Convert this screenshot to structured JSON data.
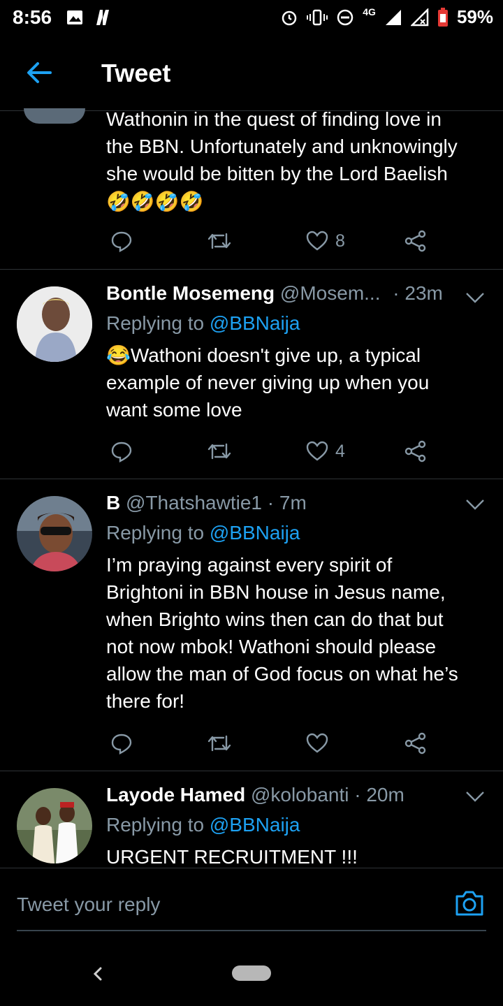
{
  "status_bar": {
    "time": "8:56",
    "network": "4G",
    "battery": "59%"
  },
  "app_bar": {
    "title": "Tweet"
  },
  "tweets": [
    {
      "body_lines": [
        "Wathonin in the quest of finding love in",
        "the BBN. Unfortunately and unknowingly",
        "she would be bitten by the Lord Baelish"
      ],
      "emoji": "🤣🤣🤣🤣",
      "likes": "8"
    },
    {
      "name": "Bontle Mosemeng",
      "handle": "@Mosem...",
      "time": "· 23m",
      "replying_label": "Replying to",
      "mention": "@BBNaija",
      "body_lines": [
        "😂Wathoni doesn't give up, a typical",
        "example of never giving up when you",
        "want some love"
      ],
      "likes": "4"
    },
    {
      "name": "B",
      "handle": "@Thatshawtie1",
      "time": "· 7m",
      "replying_label": "Replying to",
      "mention": "@BBNaija",
      "body_lines": [
        "I’m praying against every spirit of",
        "Brightoni in BBN house in Jesus name,",
        "when Brighto wins then can do that but",
        "not now mbok! Wathoni should please",
        "allow the man of God focus on what he’s",
        "there for!"
      ],
      "likes": ""
    },
    {
      "name": "Layode Hamed",
      "handle": "@kolobanti",
      "time": "· 20m",
      "replying_label": "Replying to",
      "mention": "@BBNaija",
      "body_lines": [
        "URGENT RECRUITMENT !!!"
      ]
    }
  ],
  "reply_bar": {
    "placeholder": "Tweet your reply"
  },
  "icons": {
    "reply": "speech-bubble-icon",
    "retweet": "retweet-icon",
    "like": "heart-icon",
    "share": "share-icon",
    "back": "arrow-left-icon",
    "more": "chevron-down-icon",
    "camera": "camera-icon"
  },
  "colors": {
    "background": "#000000",
    "accent": "#1da1f2",
    "secondary_text": "#8899a6"
  }
}
